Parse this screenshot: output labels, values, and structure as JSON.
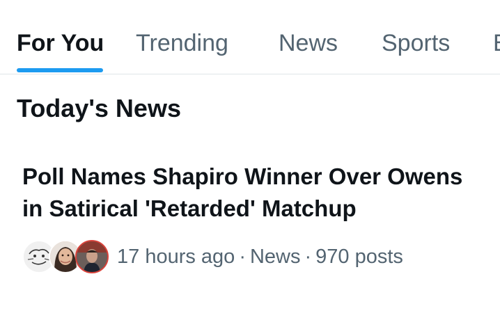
{
  "tabs": [
    {
      "label": "For You",
      "active": true
    },
    {
      "label": "Trending",
      "active": false
    },
    {
      "label": "News",
      "active": false
    },
    {
      "label": "Sports",
      "active": false
    },
    {
      "label": "E",
      "active": false
    }
  ],
  "colors": {
    "accent": "#1d9bf0",
    "text": "#0f1419",
    "secondary": "#536471",
    "divider": "#dfe5e8"
  },
  "section": {
    "title": "Today's News"
  },
  "story": {
    "headline": "Poll Names Shapiro Winner Over Owens in Satirical 'Retarded' Matchup",
    "time": "17 hours ago",
    "separator": "·",
    "category": "News",
    "posts": "970 posts",
    "avatars": [
      "meme-face-avatar",
      "woman-portrait-avatar",
      "man-portrait-avatar"
    ]
  }
}
